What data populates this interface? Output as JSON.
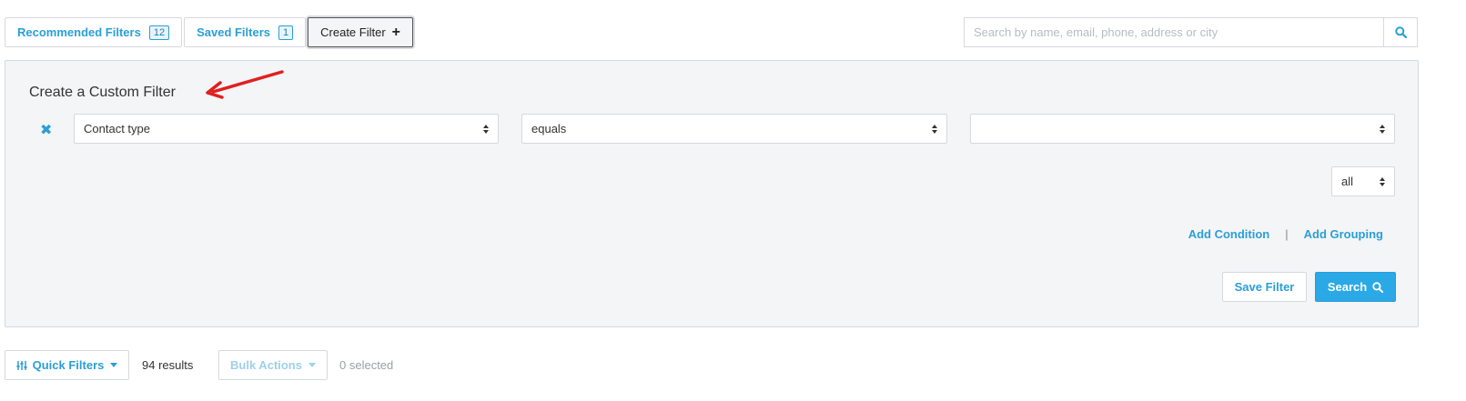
{
  "tabs": {
    "recommended_label": "Recommended Filters",
    "recommended_count": "12",
    "saved_label": "Saved Filters",
    "saved_count": "1",
    "create_label": "Create Filter",
    "create_icon": "plus-icon"
  },
  "search": {
    "placeholder": "Search by name, email, phone, address or city",
    "icon": "search-icon"
  },
  "panel": {
    "title": "Create a Custom Filter",
    "condition": {
      "field_value": "Contact type",
      "operator_value": "equals",
      "value_value": ""
    },
    "match_value": "all",
    "add_condition_label": "Add Condition",
    "separator": "|",
    "add_grouping_label": "Add Grouping",
    "save_filter_label": "Save Filter",
    "search_label": "Search"
  },
  "toolbar": {
    "quick_filters_label": "Quick Filters",
    "results_text": "94 results",
    "bulk_actions_label": "Bulk Actions",
    "selected_text": "0 selected"
  },
  "colors": {
    "accent": "#2a9fd6",
    "primary_button": "#2aa9e6",
    "panel_bg": "#f4f5f7",
    "annotation_arrow": "#e02020"
  }
}
